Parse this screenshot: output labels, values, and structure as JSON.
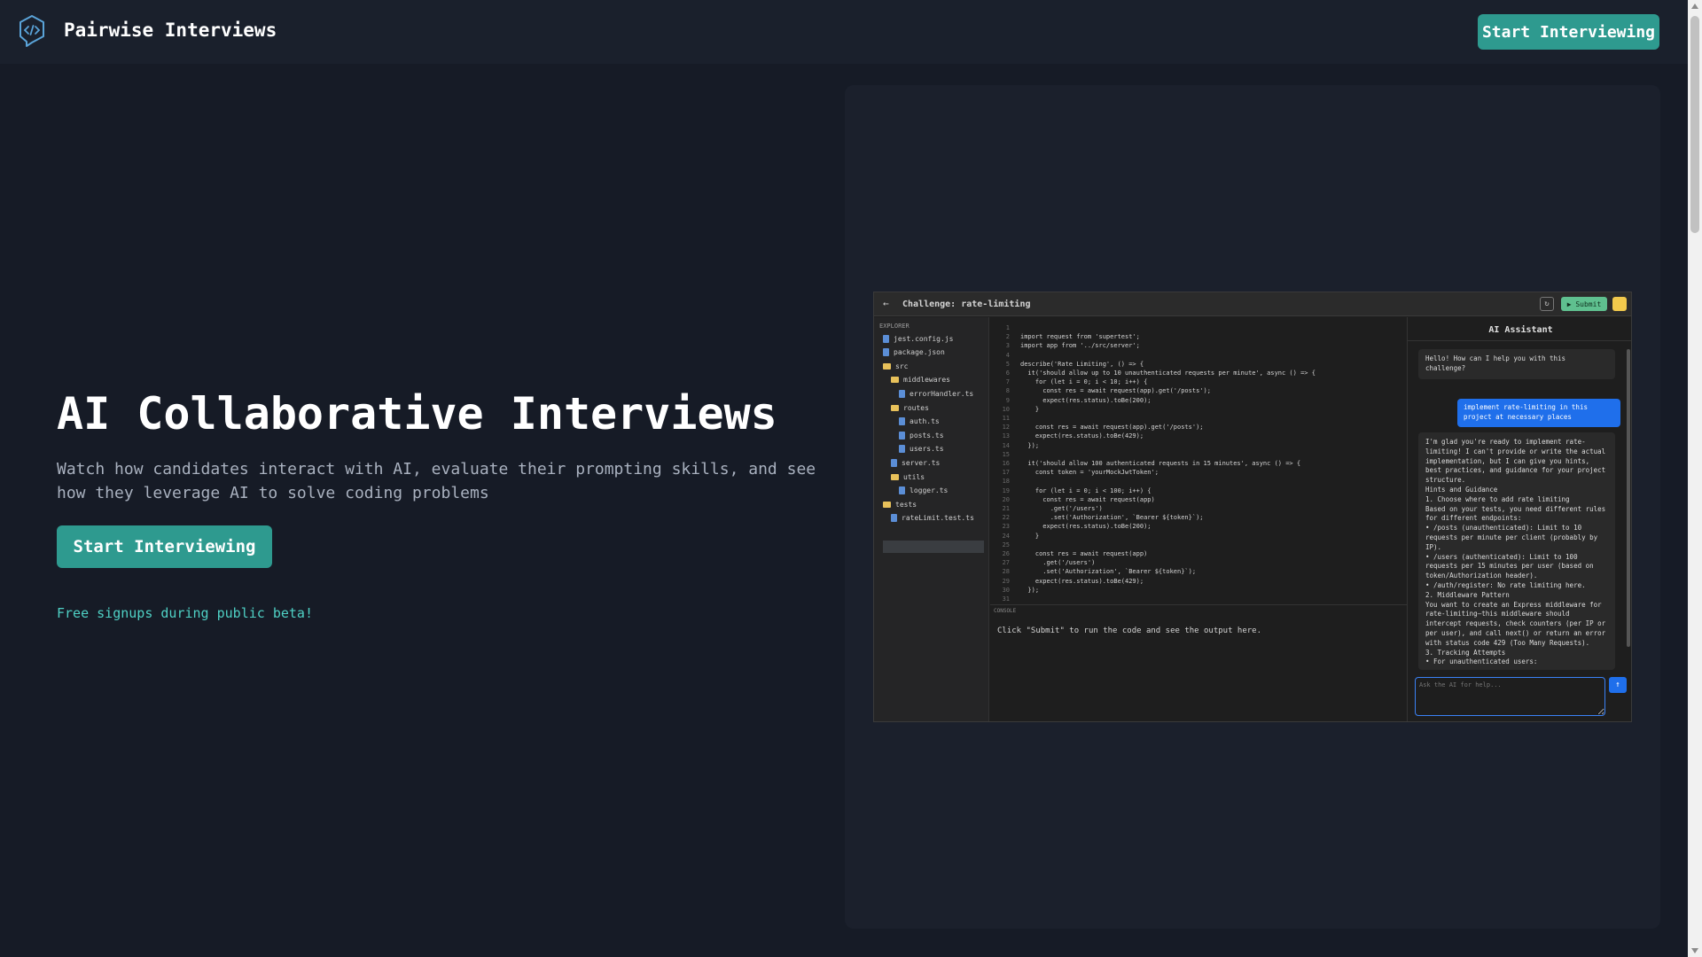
{
  "header": {
    "brand": "Pairwise Interviews",
    "cta_label": "Start Interviewing",
    "logo_icon": "code-bubble-icon"
  },
  "hero": {
    "title": "AI Collaborative Interviews",
    "subtitle": "Watch how candidates interact with AI, evaluate their prompting skills, and see how they leverage AI to solve coding problems",
    "cta_label": "Start Interviewing",
    "beta_note": "Free signups during public beta!"
  },
  "colors": {
    "accent": "#2e9a8f",
    "accent_text": "#4fd1c5",
    "background": "#161b26"
  },
  "ide": {
    "title": "Challenge: rate-limiting",
    "submit_label": "Submit",
    "explorer_label": "EXPLORER",
    "files": [
      {
        "name": "jest.config.js",
        "kind": "file",
        "depth": 0
      },
      {
        "name": "package.json",
        "kind": "file",
        "depth": 0
      },
      {
        "name": "src",
        "kind": "folder",
        "depth": 0
      },
      {
        "name": "middlewares",
        "kind": "folder",
        "depth": 1
      },
      {
        "name": "errorHandler.ts",
        "kind": "file",
        "depth": 2
      },
      {
        "name": "routes",
        "kind": "folder",
        "depth": 1
      },
      {
        "name": "auth.ts",
        "kind": "file",
        "depth": 2
      },
      {
        "name": "posts.ts",
        "kind": "file",
        "depth": 2
      },
      {
        "name": "users.ts",
        "kind": "file",
        "depth": 2
      },
      {
        "name": "server.ts",
        "kind": "file",
        "depth": 1
      },
      {
        "name": "utils",
        "kind": "folder",
        "depth": 1
      },
      {
        "name": "logger.ts",
        "kind": "file",
        "depth": 2
      },
      {
        "name": "tests",
        "kind": "folder",
        "depth": 0
      },
      {
        "name": "rateLimit.test.ts",
        "kind": "file",
        "depth": 1
      }
    ],
    "code": [
      "",
      "import request from 'supertest';",
      "import app from '../src/server';",
      "",
      "describe('Rate Limiting', () => {",
      "  it('should allow up to 10 unauthenticated requests per minute', async () => {",
      "    for (let i = 0; i < 10; i++) {",
      "      const res = await request(app).get('/posts');",
      "      expect(res.status).toBe(200);",
      "    }",
      "",
      "    const res = await request(app).get('/posts');",
      "    expect(res.status).toBe(429);",
      "  });",
      "",
      "  it('should allow 100 authenticated requests in 15 minutes', async () => {",
      "    const token = 'yourMockJwtToken';",
      "",
      "    for (let i = 0; i < 100; i++) {",
      "      const res = await request(app)",
      "        .get('/users')",
      "        .set('Authorization', `Bearer ${token}`);",
      "      expect(res.status).toBe(200);",
      "    }",
      "",
      "    const res = await request(app)",
      "      .get('/users')",
      "      .set('Authorization', `Bearer ${token}`);",
      "    expect(res.status).toBe(429);",
      "  });",
      ""
    ],
    "console_label": "CONSOLE",
    "console_message": "Click \"Submit\" to run the code and see the output here.",
    "assistant": {
      "title": "AI Assistant",
      "greeting": "Hello! How can I help you with this challenge?",
      "user_message": "implement rate-limiting in this project at necessary places",
      "reply": [
        "I'm glad you're ready to implement rate-limiting! I can't provide or write the actual implementation, but I can give you hints, best practices, and guidance for your project structure.",
        "Hints and Guidance",
        "1. Choose where to add rate limiting",
        "Based on your tests, you need different rules for different endpoints:",
        "• /posts (unauthenticated): Limit to 10 requests per minute per client (probably by IP).",
        "• /users (authenticated): Limit to 100 requests per 15 minutes per user (based on token/Authorization header).",
        "• /auth/register: No rate limiting here.",
        "2. Middleware Pattern",
        "You want to create an Express middleware for rate-limiting—this middleware should intercept requests, check counters (per IP or per user), and call next() or return an error with status code 429 (Too Many Requests).",
        "3. Tracking Attempts",
        "• For unauthenticated users:"
      ],
      "input_placeholder": "Ask the AI for help..."
    }
  }
}
